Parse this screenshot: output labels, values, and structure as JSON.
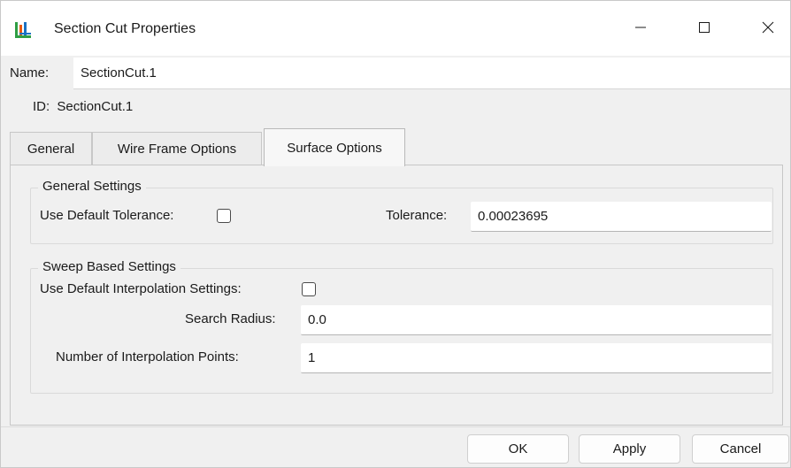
{
  "window": {
    "title": "Section Cut Properties",
    "icons": {
      "app": "section-cut-app-icon",
      "minimize": "minimize-icon",
      "maximize": "maximize-icon",
      "close": "close-icon"
    }
  },
  "name": {
    "label": "Name:",
    "value": "SectionCut.1"
  },
  "id": {
    "label": "ID:",
    "value": "SectionCut.1"
  },
  "tabs": [
    {
      "label": "General",
      "active": false
    },
    {
      "label": "Wire Frame Options",
      "active": false
    },
    {
      "label": "Surface Options",
      "active": true
    }
  ],
  "general_settings": {
    "title": "General Settings",
    "use_default_tolerance_label": "Use Default Tolerance:",
    "use_default_tolerance_checked": false,
    "tolerance_label": "Tolerance:",
    "tolerance_value": "0.00023695"
  },
  "sweep_settings": {
    "title": "Sweep Based Settings",
    "use_default_interp_label": "Use Default Interpolation Settings:",
    "use_default_interp_checked": false,
    "search_radius_label": "Search Radius:",
    "search_radius_value": "0.0",
    "num_points_label": "Number of Interpolation Points:",
    "num_points_value": "1"
  },
  "buttons": {
    "ok": "OK",
    "apply": "Apply",
    "cancel": "Cancel"
  },
  "colors": {
    "window_bg": "#f0f0f0",
    "titlebar_bg": "#ffffff",
    "field_bg": "#ffffff"
  }
}
